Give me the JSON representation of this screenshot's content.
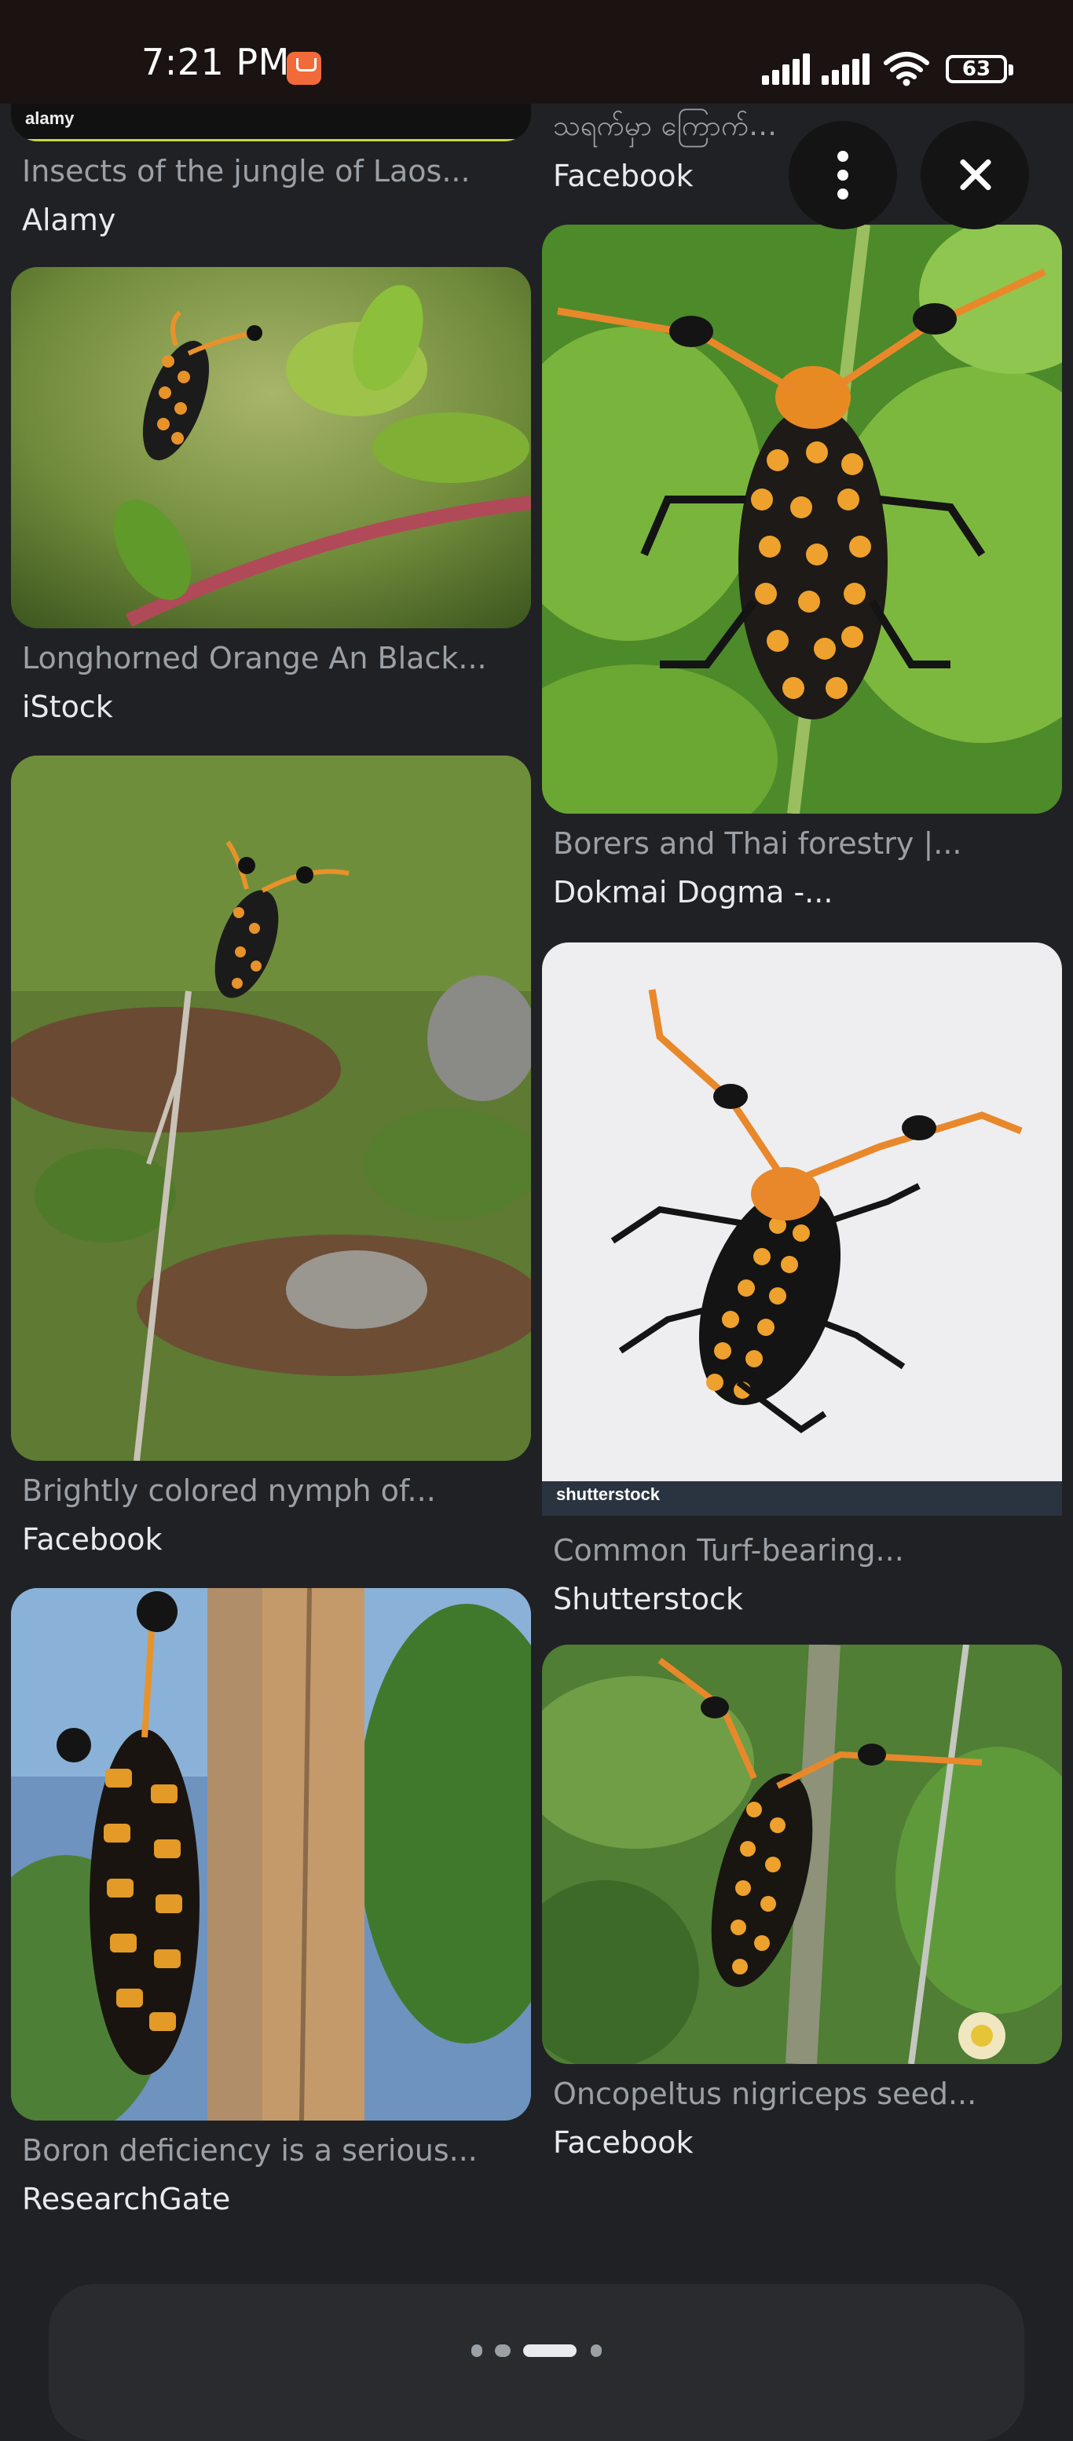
{
  "status_bar": {
    "time": "7:21 PM",
    "battery": "63",
    "icons": [
      "notification-app-icon",
      "signal-icon",
      "signal-icon",
      "wifi-icon",
      "battery-icon"
    ]
  },
  "actions": {
    "more_icon": "more-vert-icon",
    "close_icon": "close-icon"
  },
  "results": [
    {
      "caption": "Insects of the jungle of Laos...",
      "source": "Alamy",
      "watermark": "alamy"
    },
    {
      "caption": "သရက်မှာ ကြောက်ရေတဲ့ ပင်စည်...",
      "source": "Facebook"
    },
    {
      "caption": "Longhorned Orange An Black...",
      "source": "iStock"
    },
    {
      "caption": "Borers and Thai forestry |...",
      "source": "Dokmai Dogma -..."
    },
    {
      "caption": "Brightly colored nymph of...",
      "source": "Facebook"
    },
    {
      "caption": "Common Turf-bearing...",
      "source": "Shutterstock",
      "watermark": "shutterstock"
    },
    {
      "caption": "Boron deficiency is a serious...",
      "source": "ResearchGate"
    },
    {
      "caption": "Oncopeltus nigriceps seed...",
      "source": "Facebook"
    }
  ],
  "colors": {
    "background": "#202124",
    "status_bar": "#1b1212",
    "caption": "#9aa0a6",
    "source": "#e8eaed"
  }
}
